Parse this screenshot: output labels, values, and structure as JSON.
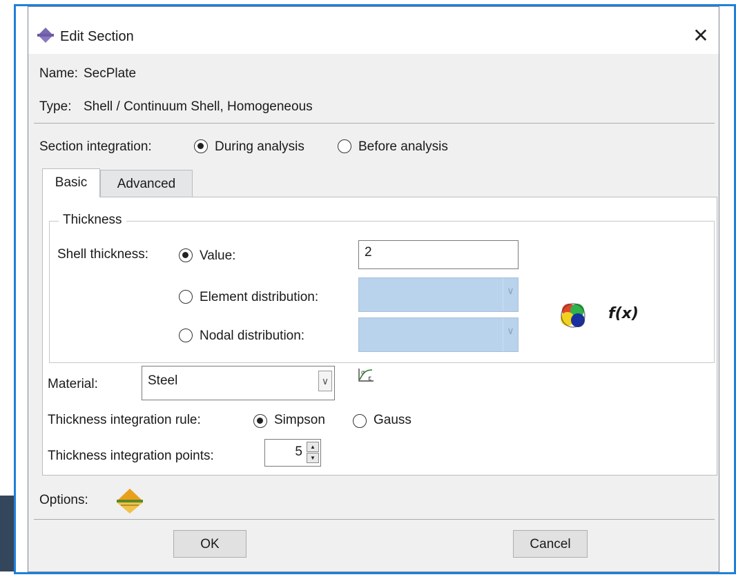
{
  "dialog": {
    "title": "Edit Section",
    "close_glyph": "✕"
  },
  "info": {
    "name_label": "Name:",
    "name_value": "SecPlate",
    "type_label": "Type:",
    "type_value": "Shell / Continuum Shell, Homogeneous"
  },
  "section_integration": {
    "label": "Section integration:",
    "options": [
      {
        "label": "During analysis",
        "selected": true
      },
      {
        "label": "Before analysis",
        "selected": false
      }
    ]
  },
  "tabs": [
    {
      "label": "Basic",
      "active": true
    },
    {
      "label": "Advanced",
      "active": false
    }
  ],
  "thickness": {
    "group_title": "Thickness",
    "shell_label": "Shell thickness:",
    "value_option": "Value:",
    "value": "2",
    "element_option": "Element distribution:",
    "nodal_option": "Nodal distribution:",
    "fx_label": "f(x)",
    "icons": [
      "color-distribution-icon"
    ]
  },
  "material": {
    "label": "Material:",
    "value": "Steel",
    "icon": "stress-strain-icon"
  },
  "integration_rule": {
    "label": "Thickness integration rule:",
    "options": [
      {
        "label": "Simpson",
        "selected": true
      },
      {
        "label": "Gauss",
        "selected": false
      }
    ]
  },
  "integration_points": {
    "label": "Thickness integration points:",
    "value": "5"
  },
  "options": {
    "label": "Options:",
    "icon": "section-options-icon"
  },
  "buttons": {
    "ok": "OK",
    "cancel": "Cancel"
  },
  "colors": {
    "dialog_border": "#1f7fd8",
    "disabled_combo": "#b9d3ec",
    "background": "#f0f0f0"
  }
}
